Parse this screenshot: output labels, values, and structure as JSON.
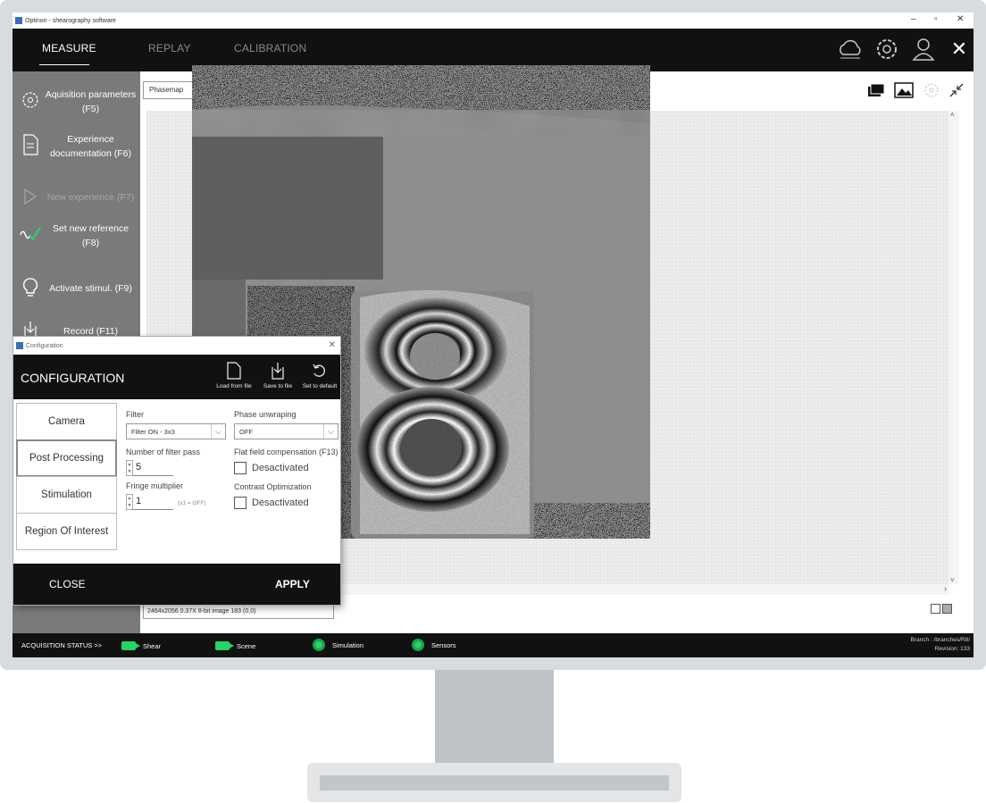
{
  "window": {
    "title": "Optinon - shearography software"
  },
  "nav": {
    "tabs": [
      {
        "label": "MEASURE"
      },
      {
        "label": "REPLAY"
      },
      {
        "label": "CALIBRATION"
      }
    ],
    "icons": [
      "cloud-icon",
      "gear-icon",
      "user-icon",
      "close-icon"
    ]
  },
  "sidebar": {
    "items": [
      {
        "label": "Aquisition parameters (F5)",
        "icon": "gear-icon"
      },
      {
        "label": "Experience documentation (F6)",
        "icon": "document-icon"
      },
      {
        "label": "New experience (F7)",
        "icon": "play-icon",
        "disabled": true
      },
      {
        "label": "Set new reference (F8)",
        "icon": "wave-check-icon"
      },
      {
        "label": "Activate stimul. (F9)",
        "icon": "bulb-icon"
      },
      {
        "label": "Record (F11)",
        "icon": "download-icon"
      }
    ]
  },
  "viewer": {
    "mode_select": "Phasemap",
    "status_text": "2464x2056 0.37X 8-bit image 183   (0,0)"
  },
  "statusbar": {
    "label": "ACQUISITION STATUS >>",
    "items": [
      {
        "label": "Shear",
        "icon": "camera-icon"
      },
      {
        "label": "Scene",
        "icon": "camera-icon"
      },
      {
        "label": "Simulation",
        "icon": "status-dot-icon"
      },
      {
        "label": "Sensors",
        "icon": "status-dot-icon"
      }
    ],
    "branch": "Branch : /branches/R8/",
    "revision": "Revision: 133",
    "accent": "#25d366"
  },
  "config": {
    "window_title": "Configuration",
    "heading": "CONFIGURATION",
    "actions": [
      {
        "label": "Load from file",
        "icon": "file-icon"
      },
      {
        "label": "Save to file",
        "icon": "save-icon"
      },
      {
        "label": "Set to default",
        "icon": "undo-icon"
      }
    ],
    "tabs": [
      {
        "label": "Camera"
      },
      {
        "label": "Post Processing",
        "active": true
      },
      {
        "label": "Stimulation"
      },
      {
        "label": "Region Of Interest"
      }
    ],
    "filter_label": "Filter",
    "filter_value": "Filter ON - 3x3",
    "filter_pass_label": "Number of filter pass",
    "filter_pass_value": "5",
    "fringe_label": "Fringe multiplier",
    "fringe_value": "1",
    "fringe_hint": "(x1 = OFF)",
    "unwrap_label": "Phase unwraping",
    "unwrap_value": "OFF",
    "flatfield_label": "Flat field compensation (F13)",
    "flatfield_value": "Desactivated",
    "contrast_label": "Contrast Optimization",
    "contrast_value": "Desactivated",
    "close_label": "CLOSE",
    "apply_label": "APPLY"
  }
}
